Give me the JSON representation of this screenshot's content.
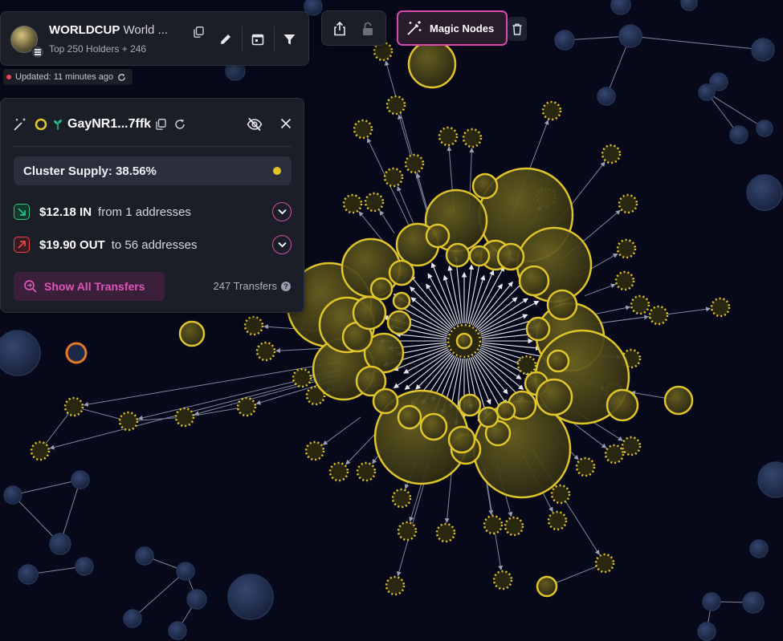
{
  "header": {
    "token_symbol": "WORLDCUP",
    "token_name": "World ...",
    "subtitle": "Top 250 Holders + 246",
    "icons": [
      "copy-icon",
      "pencil-icon",
      "calendar-icon",
      "filter-icon"
    ]
  },
  "status": {
    "updated": "Updated: 11 minutes ago",
    "live_color": "#e5484d"
  },
  "toolbar": {
    "share_icon": "share-icon",
    "lock_icon": "lock-icon",
    "magic_nodes_label": "Magic Nodes",
    "trash_icon": "trash-icon"
  },
  "cluster": {
    "wallet": "GayNR1...7ffk",
    "supply_label": "Cluster Supply: 38.56%",
    "supply_color": "#e0c52a",
    "inflow": {
      "amount": "$12.18 IN",
      "description": "from 1 addresses",
      "color": "#29c28a"
    },
    "outflow": {
      "amount": "$19.90 OUT",
      "description": "to 56 addresses",
      "color": "#e5484d"
    },
    "show_all_label": "Show All Transfers",
    "transfers_count": "247 Transfers",
    "accent": "#d84ab0"
  },
  "graph_colors": {
    "cluster": "#e0c52a",
    "cluster_fill": "#4e4719",
    "other": "#2d3e63",
    "highlight": "#e07a2a"
  }
}
